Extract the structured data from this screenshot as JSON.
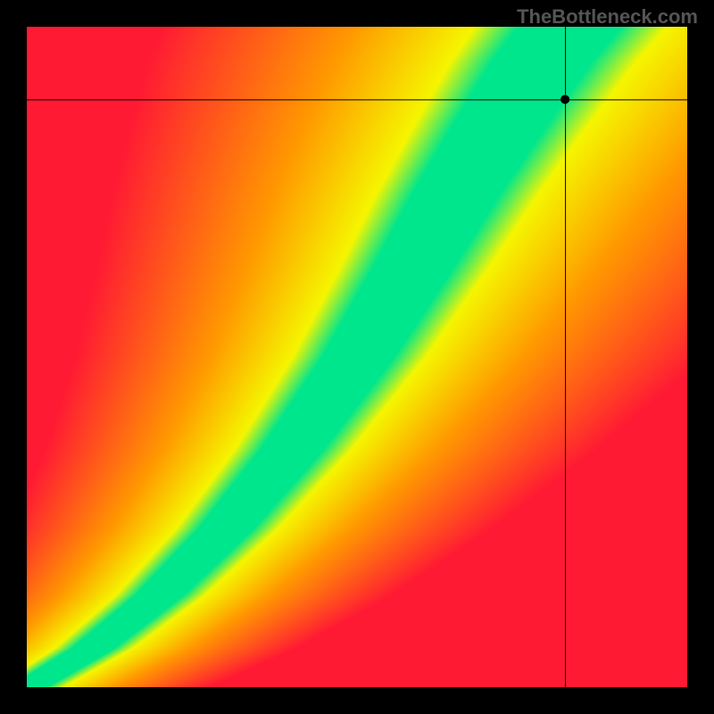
{
  "watermark": "TheBottleneck.com",
  "chart_data": {
    "type": "heatmap",
    "title": "",
    "xlabel": "",
    "ylabel": "",
    "xlim": [
      0,
      1
    ],
    "ylim": [
      0,
      1
    ],
    "crosshair": {
      "x": 0.815,
      "y": 0.89
    },
    "gradient_description": "Diagonal performance band heatmap. A curved green 'optimal' band runs from bottom-left corner to upper-right area. Colors transition red→orange→yellow→green→yellow→orange→red perpendicular to the band. Band widens as it progresses toward upper-right.",
    "color_scale": {
      "optimal": "#00e68c",
      "near": "#f5f500",
      "mid": "#ff9900",
      "far": "#ff1a33"
    },
    "band_curve": {
      "description": "Approximate centerline of green optimal band as (x, y) fractions of plot area, origin bottom-left",
      "points": [
        [
          0.0,
          0.0
        ],
        [
          0.1,
          0.06
        ],
        [
          0.2,
          0.14
        ],
        [
          0.3,
          0.24
        ],
        [
          0.4,
          0.36
        ],
        [
          0.5,
          0.5
        ],
        [
          0.58,
          0.63
        ],
        [
          0.65,
          0.75
        ],
        [
          0.72,
          0.86
        ],
        [
          0.78,
          0.95
        ],
        [
          0.82,
          1.0
        ]
      ],
      "half_width": [
        0.01,
        0.015,
        0.02,
        0.025,
        0.03,
        0.035,
        0.04,
        0.045,
        0.05,
        0.055,
        0.06
      ]
    },
    "marker": {
      "x": 0.815,
      "y": 0.89,
      "radius_px": 5,
      "color": "#000000"
    }
  }
}
